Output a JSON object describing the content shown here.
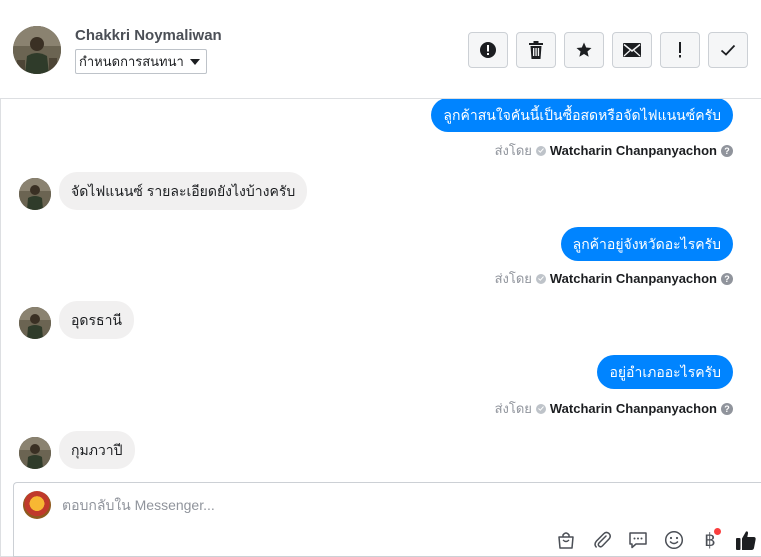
{
  "header": {
    "contact_name": "Chakkri Noymaliwan",
    "label_select": "กำหนดการสนทนา",
    "actions": [
      {
        "name": "mark-spam-button",
        "icon": "alert-circle-icon"
      },
      {
        "name": "delete-button",
        "icon": "trash-icon"
      },
      {
        "name": "star-button",
        "icon": "star-icon"
      },
      {
        "name": "mark-unread-button",
        "icon": "envelope-icon"
      },
      {
        "name": "follow-up-button",
        "icon": "exclamation-icon"
      },
      {
        "name": "mark-done-button",
        "icon": "checkmark-icon"
      }
    ]
  },
  "messages": [
    {
      "direction": "out",
      "text": "ลูกค้าสนใจคันนี้เป็นซื้อสดหรือจัดไฟแนนซ์ครับ",
      "sent_by_label": "ส่งโดย",
      "sender": "Watcharin Chanpanyachon"
    },
    {
      "direction": "in",
      "text": "จัดไฟแนนซ์ รายละเอียดยังไงบ้างครับ"
    },
    {
      "direction": "out",
      "text": "ลูกค้าอยู่จังหวัดอะไรครับ",
      "sent_by_label": "ส่งโดย",
      "sender": "Watcharin Chanpanyachon"
    },
    {
      "direction": "in",
      "text": "อุดรธานี"
    },
    {
      "direction": "out",
      "text": "อยู่อำเภออะไรครับ",
      "sent_by_label": "ส่งโดย",
      "sender": "Watcharin Chanpanyachon"
    },
    {
      "direction": "in",
      "text": "กุมภวาปี"
    }
  ],
  "composer": {
    "placeholder": "ตอบกลับใน Messenger...",
    "tools": [
      "shopping-bag-icon",
      "paperclip-icon",
      "saved-reply-icon",
      "emoji-icon",
      "baht-payment-icon",
      "thumbs-up-icon"
    ],
    "baht_symbol": "฿"
  },
  "colors": {
    "outgoing_bubble": "#0084ff",
    "incoming_bubble": "#f1f0f0",
    "like_icon": "#1c1e21",
    "notification_dot": "#fa3e3e"
  }
}
